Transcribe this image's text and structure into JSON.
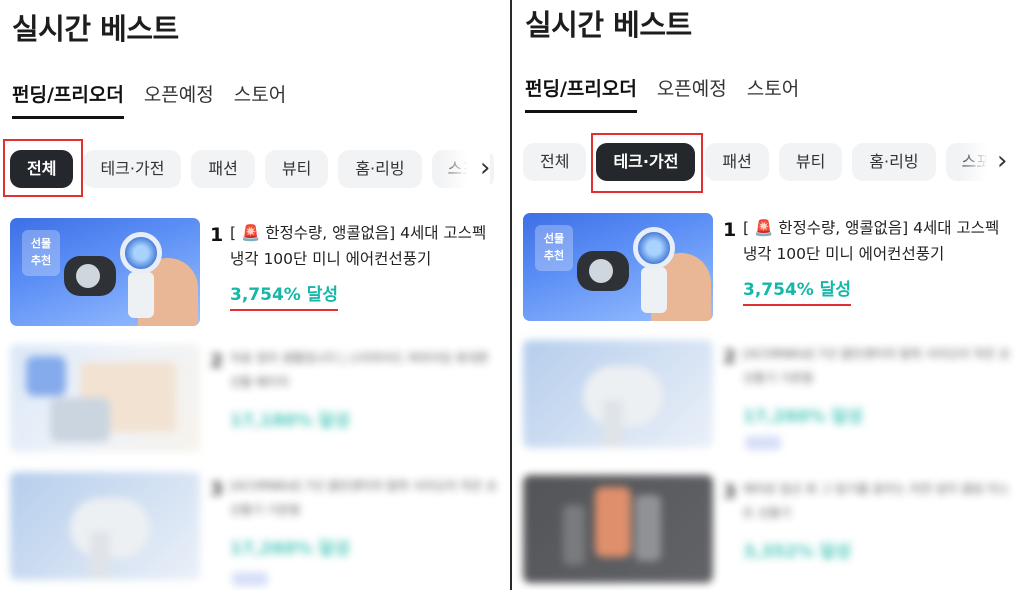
{
  "left": {
    "title": "실시간 베스트",
    "tabs": [
      "펀딩/프리오더",
      "오픈예정",
      "스토어"
    ],
    "chips": [
      "전체",
      "테크·가전",
      "패션",
      "뷰티",
      "홈·리빙",
      "스포"
    ],
    "items": [
      {
        "rank": "1",
        "name": "[ 🚨 한정수량, 앵콜없음] 4세대 고스펙 냉각 100단 미니 에어컨선풍기",
        "rate": "3,754% 달성",
        "badge": "선물\n추천"
      },
      {
        "rank": "2",
        "name": "자료 정리 생활입니다 | 스타마이드 여라이딩 휴대폰 선물 패키지",
        "rate": "17,180% 달성"
      },
      {
        "rank": "3",
        "name": "[ACORNKid] 7년 클린센터의 탈취 서리오리 작은 손선풍기 기본형",
        "rate": "17,260% 달성"
      }
    ]
  },
  "right": {
    "title": "실시간 베스트",
    "tabs": [
      "펀딩/프리오더",
      "오픈예정",
      "스토어"
    ],
    "chips": [
      "전체",
      "테크·가전",
      "패션",
      "뷰티",
      "홈·리빙",
      "스포"
    ],
    "items": [
      {
        "rank": "1",
        "name": "[ 🚨 한정수량, 앵콜없음] 4세대 고스펙 냉각 100단 미니 에어컨선풍기",
        "rate": "3,754% 달성",
        "badge": "선물\n추천"
      },
      {
        "rank": "2",
        "name": "[ACORNKid] 7년 클린센터의 탈취 서리오리 작은 손선풍기 기본형",
        "rate": "17,260% 달성"
      },
      {
        "rank": "3",
        "name": "에어로 일산 휴 그 탕기를 꿈꾸는 자연 냉각 클링 미스트 선풍기",
        "rate": "3,352% 달성"
      }
    ]
  },
  "colors": {
    "accent": "#15b7a7",
    "highlight": "#e23030",
    "chip_active": "#24272b"
  }
}
